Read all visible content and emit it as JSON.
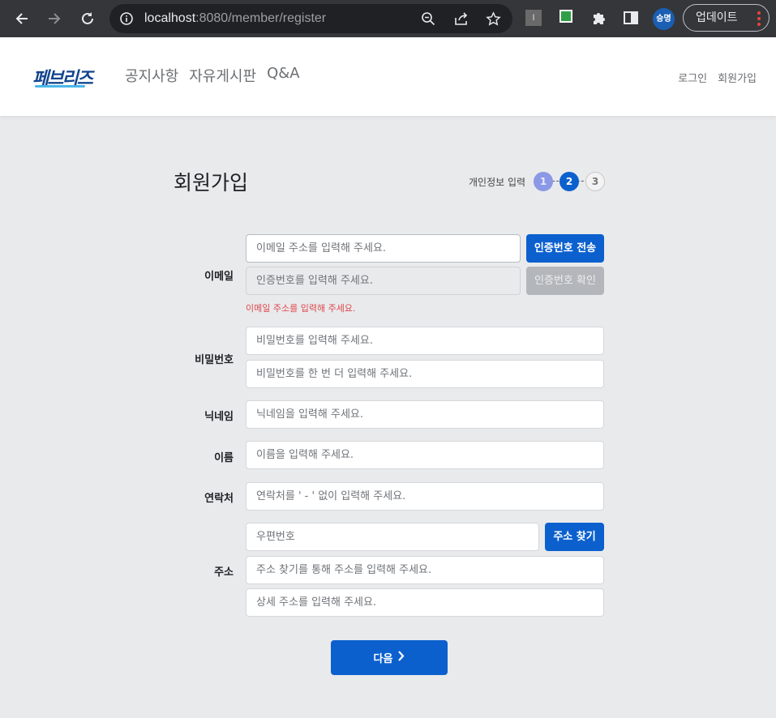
{
  "browser": {
    "url_host": "localhost",
    "url_path": ":8080/member/register",
    "extension_label": "I",
    "avatar_text": "승명",
    "update_label": "업데이트"
  },
  "site": {
    "logo_text": "페브리즈",
    "nav": [
      "공지사항",
      "자유게시판",
      "Q&A"
    ],
    "user_nav": [
      "로그인",
      "회원가입"
    ]
  },
  "page": {
    "title": "회원가입",
    "step_label": "개인정보 입력",
    "steps": [
      "1",
      "2",
      "3"
    ],
    "current_step": 2
  },
  "form": {
    "email": {
      "label": "이메일",
      "placeholder": "이메일 주소를 입력해 주세요.",
      "send_button": "인증번호 전송",
      "code_placeholder": "인증번호를 입력해 주세요.",
      "confirm_button": "인증번호 확인",
      "error": "이메일 주소를 입력해 주세요."
    },
    "password": {
      "label": "비밀번호",
      "placeholder": "비밀번호를 입력해 주세요.",
      "confirm_placeholder": "비밀번호를 한 번 더 입력해 주세요."
    },
    "nickname": {
      "label": "닉네임",
      "placeholder": "닉네임을 입력해 주세요."
    },
    "name": {
      "label": "이름",
      "placeholder": "이름을 입력해 주세요."
    },
    "phone": {
      "label": "연락처",
      "placeholder": "연락처를 ' - ' 없이 입력해 주세요."
    },
    "address": {
      "label": "주소",
      "zip_placeholder": "우편번호",
      "search_button": "주소 찾기",
      "address_placeholder": "주소 찾기를 통해 주소를 입력해 주세요.",
      "detail_placeholder": "상세 주소를 입력해 주세요."
    },
    "next_button": "다음"
  },
  "colors": {
    "primary": "#0b60ce",
    "error": "#e0474c",
    "page_bg": "#e9eaec"
  }
}
